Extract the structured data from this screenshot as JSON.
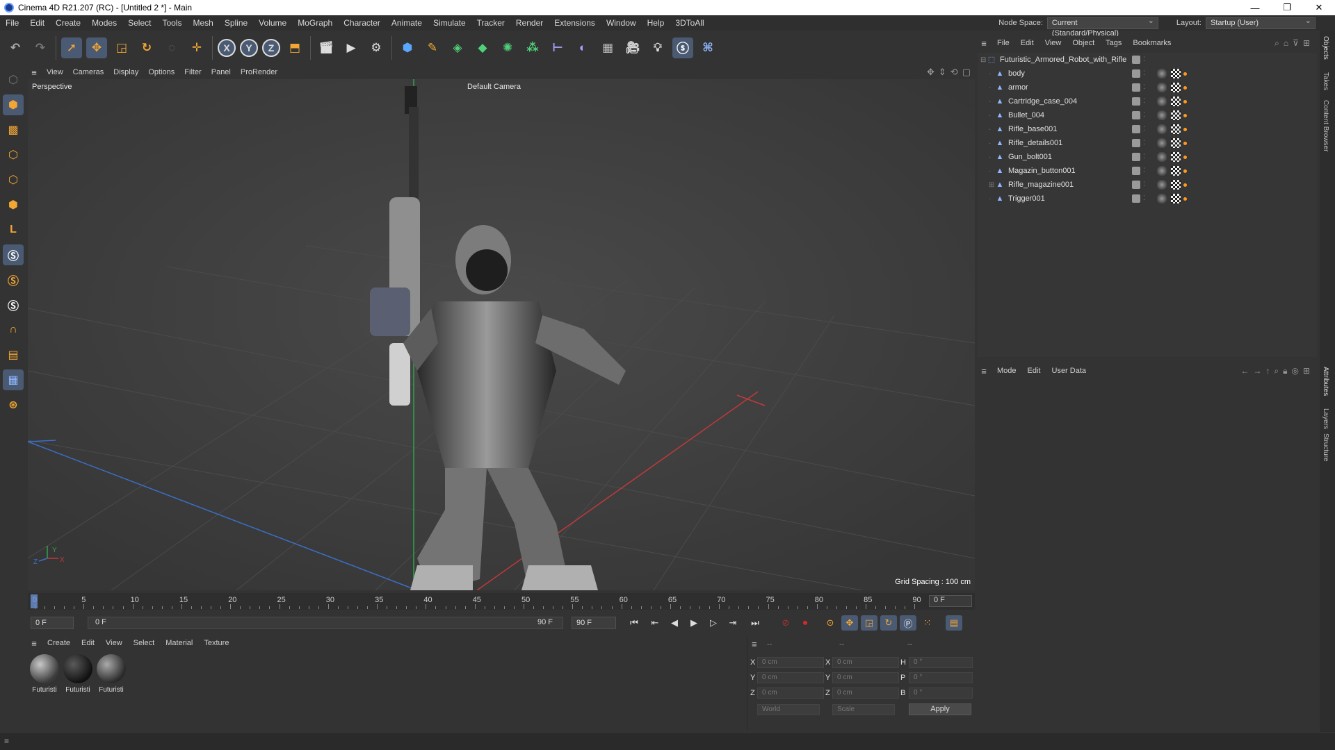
{
  "window": {
    "title": "Cinema 4D R21.207 (RC) - [Untitled 2 *] - Main",
    "controls": [
      "—",
      "❐",
      "✕"
    ]
  },
  "menubar": {
    "items": [
      "File",
      "Edit",
      "Create",
      "Modes",
      "Select",
      "Tools",
      "Mesh",
      "Spline",
      "Volume",
      "MoGraph",
      "Character",
      "Animate",
      "Simulate",
      "Tracker",
      "Render",
      "Extensions",
      "Window",
      "Help",
      "3DToAll"
    ],
    "node_space_label": "Node Space:",
    "node_space_value": "Current (Standard/Physical)",
    "layout_label": "Layout:",
    "layout_value": "Startup (User)"
  },
  "toolbar": {
    "icons": [
      "undo-icon",
      "redo-icon",
      "select-icon",
      "move-icon",
      "scale-icon",
      "rotate-icon",
      "live-select-icon",
      "transform-icon",
      "x-axis-icon",
      "y-axis-icon",
      "z-axis-icon",
      "coordinate-system-icon",
      "render-view-icon",
      "render-picture-viewer-icon",
      "render-settings-icon",
      "cube-icon",
      "pen-icon",
      "subdivision-icon",
      "extrude-icon",
      "mograph-cloner-icon",
      "array-icon",
      "deformer-icon",
      "spline-icon",
      "floor-icon",
      "camera-icon",
      "light-icon",
      "sketch-icon",
      "python-icon"
    ],
    "axis_labels": [
      "X",
      "Y",
      "Z"
    ]
  },
  "lefttools": {
    "icons": [
      "make-editable-icon",
      "model-mode-icon",
      "texture-mode-icon",
      "points-mode-icon",
      "edges-mode-icon",
      "polygons-mode-icon",
      "axis-mode-icon",
      "snap-s1-icon",
      "snap-s2-icon",
      "snap-s3-icon",
      "magnet-icon",
      "workplane-icon",
      "locked-workplane-icon",
      "solo-icon"
    ]
  },
  "viewport": {
    "menu": [
      "View",
      "Cameras",
      "Display",
      "Options",
      "Filter",
      "Panel",
      "ProRender"
    ],
    "label": "Perspective",
    "camera": "Default Camera",
    "grid_spacing": "Grid Spacing : 100 cm",
    "axis_x": "X",
    "axis_y": "Y",
    "axis_z": "Z"
  },
  "timeline": {
    "ticks": [
      "0",
      "5",
      "10",
      "15",
      "20",
      "25",
      "30",
      "35",
      "40",
      "45",
      "50",
      "55",
      "60",
      "65",
      "70",
      "75",
      "80",
      "85",
      "90"
    ],
    "current_frame_box": "0 F",
    "start_field": "0 F",
    "range_start": "0 F",
    "range_end": "90 F",
    "end_field": "90 F"
  },
  "transport": {
    "buttons": [
      "go-to-start-icon",
      "previous-key-icon",
      "previous-frame-icon",
      "play-icon",
      "next-frame-icon",
      "go-to-end-icon"
    ],
    "tools": [
      "autokey-icon",
      "record-icon",
      "keyframe-selection-icon",
      "position-key-icon",
      "scale-key-icon",
      "rotation-key-icon",
      "parameter-key-icon",
      "pla-key-icon",
      "timeline-icon"
    ]
  },
  "material_manager": {
    "menu": [
      "Create",
      "Edit",
      "View",
      "Select",
      "Material",
      "Texture"
    ],
    "materials": [
      {
        "name": "Futuristi"
      },
      {
        "name": "Futuristi"
      },
      {
        "name": "Futuristi"
      }
    ]
  },
  "coordinates": {
    "header": [
      "--",
      "--",
      "--"
    ],
    "rows": [
      {
        "a": "X",
        "av": "0 cm",
        "b": "X",
        "bv": "0 cm",
        "c": "H",
        "cv": "0 °"
      },
      {
        "a": "Y",
        "av": "0 cm",
        "b": "Y",
        "bv": "0 cm",
        "c": "P",
        "cv": "0 °"
      },
      {
        "a": "Z",
        "av": "0 cm",
        "b": "Z",
        "bv": "0 cm",
        "c": "B",
        "cv": "0 °"
      }
    ],
    "mode1": "World",
    "mode2": "Scale",
    "apply": "Apply"
  },
  "object_manager": {
    "menu": [
      "File",
      "Edit",
      "View",
      "Object",
      "Tags",
      "Bookmarks"
    ],
    "root": "Futuristic_Armored_Robot_with_Rifle",
    "children": [
      "body",
      "armor",
      "Cartridge_case_004",
      "Bullet_004",
      "Rifle_base001",
      "Rifle_details001",
      "Gun_bolt001",
      "Magazin_button001",
      "Rifle_magazine001",
      "Trigger001"
    ]
  },
  "attribute_manager": {
    "menu": [
      "Mode",
      "Edit",
      "User Data"
    ]
  },
  "right_tabs": [
    "Objects",
    "Takes",
    "Content Browser",
    "Attributes",
    "Layers",
    "Structure"
  ],
  "colors": {
    "accent": "#4b5a73",
    "tag_orange": "#ff9a1f",
    "axis_red": "#c0393b",
    "axis_green": "#2fa34d",
    "axis_blue": "#3a6fc7",
    "record_red": "#d42a2a"
  }
}
